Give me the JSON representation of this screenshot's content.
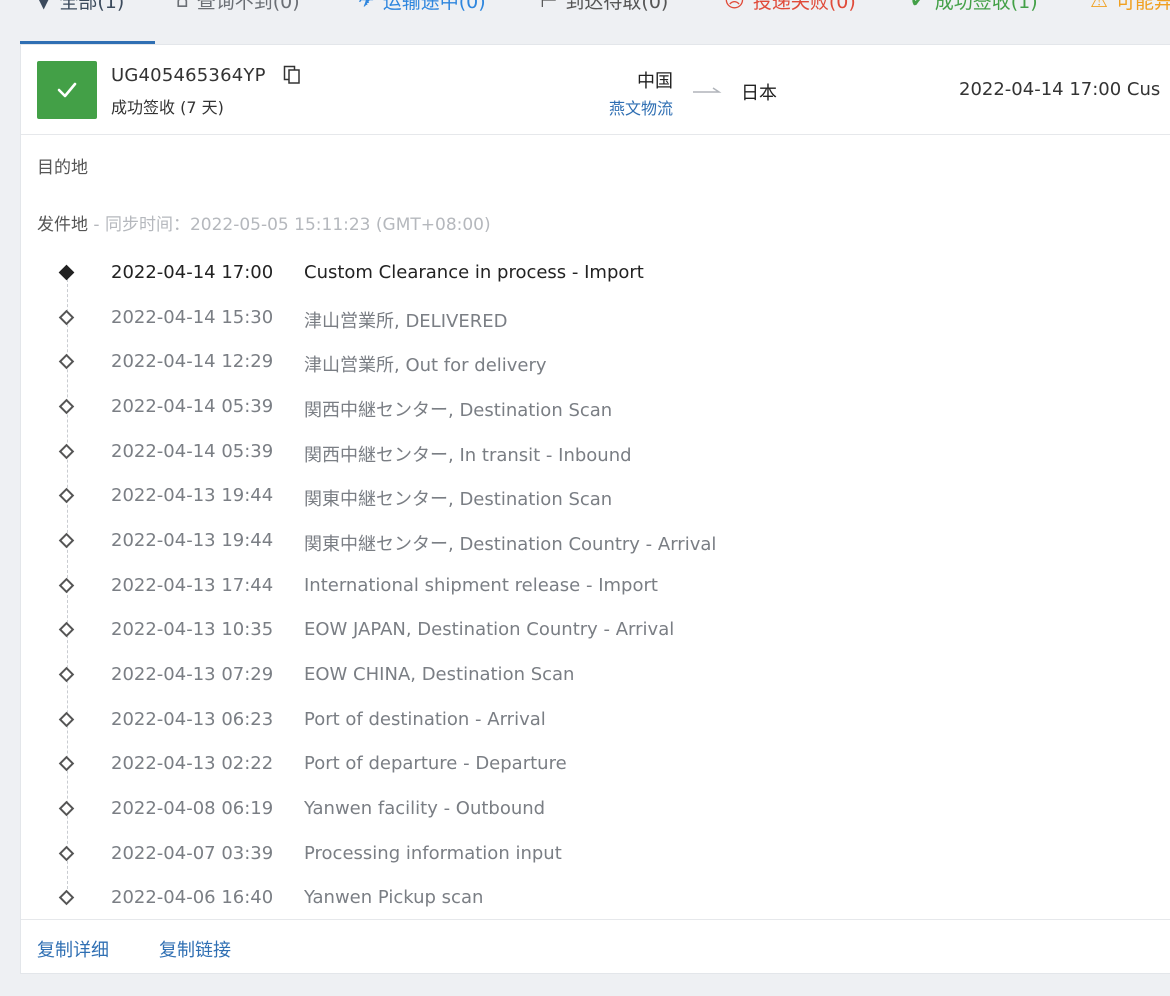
{
  "tabs": [
    {
      "label": "全部(1)",
      "icon": "filter-icon"
    },
    {
      "label": "查询不到(0)",
      "icon": "lock-icon"
    },
    {
      "label": "运输途中(0)",
      "icon": "plane-icon"
    },
    {
      "label": "到达待取(0)",
      "icon": "pickup-icon"
    },
    {
      "label": "投递失败(0)",
      "icon": "sad-face-icon"
    },
    {
      "label": "成功签收(1)",
      "icon": "check-icon"
    },
    {
      "label": "可能异常",
      "icon": "warning-icon"
    }
  ],
  "shipment": {
    "tracking_number": "UG405465364YP",
    "status": "成功签收 (7 天)",
    "origin_country": "中国",
    "carrier": "燕文物流",
    "destination_country": "日本",
    "latest_event": "2022-04-14 17:00  Cus"
  },
  "sections": {
    "destination_label": "目的地",
    "origin_label": "发件地",
    "sync_text": " - 同步时间：2022-05-05 15:11:23 (GMT+08:00)"
  },
  "events": [
    {
      "time": "2022-04-14 17:00",
      "desc": "Custom Clearance in process - Import"
    },
    {
      "time": "2022-04-14 15:30",
      "desc": "津山営業所, DELIVERED"
    },
    {
      "time": "2022-04-14 12:29",
      "desc": "津山営業所, Out for delivery"
    },
    {
      "time": "2022-04-14 05:39",
      "desc": "関西中継センター, Destination Scan"
    },
    {
      "time": "2022-04-14 05:39",
      "desc": "関西中継センター, In transit - Inbound"
    },
    {
      "time": "2022-04-13 19:44",
      "desc": "関東中継センター, Destination Scan"
    },
    {
      "time": "2022-04-13 19:44",
      "desc": "関東中継センター, Destination Country - Arrival"
    },
    {
      "time": "2022-04-13 17:44",
      "desc": "International shipment release - Import"
    },
    {
      "time": "2022-04-13 10:35",
      "desc": "EOW JAPAN, Destination Country - Arrival"
    },
    {
      "time": "2022-04-13 07:29",
      "desc": "EOW CHINA, Destination Scan"
    },
    {
      "time": "2022-04-13 06:23",
      "desc": "Port of destination - Arrival"
    },
    {
      "time": "2022-04-13 02:22",
      "desc": "Port of departure - Departure"
    },
    {
      "time": "2022-04-08 06:19",
      "desc": "Yanwen facility - Outbound"
    },
    {
      "time": "2022-04-07 03:39",
      "desc": "Processing information input"
    },
    {
      "time": "2022-04-06 16:40",
      "desc": "Yanwen Pickup scan"
    }
  ],
  "footer": {
    "copy_details": "复制详细",
    "copy_link": "复制链接"
  },
  "colors": {
    "success": "#43a047",
    "link": "#2f6fb3",
    "fail": "#e04b3a",
    "warning": "#f0a020"
  }
}
